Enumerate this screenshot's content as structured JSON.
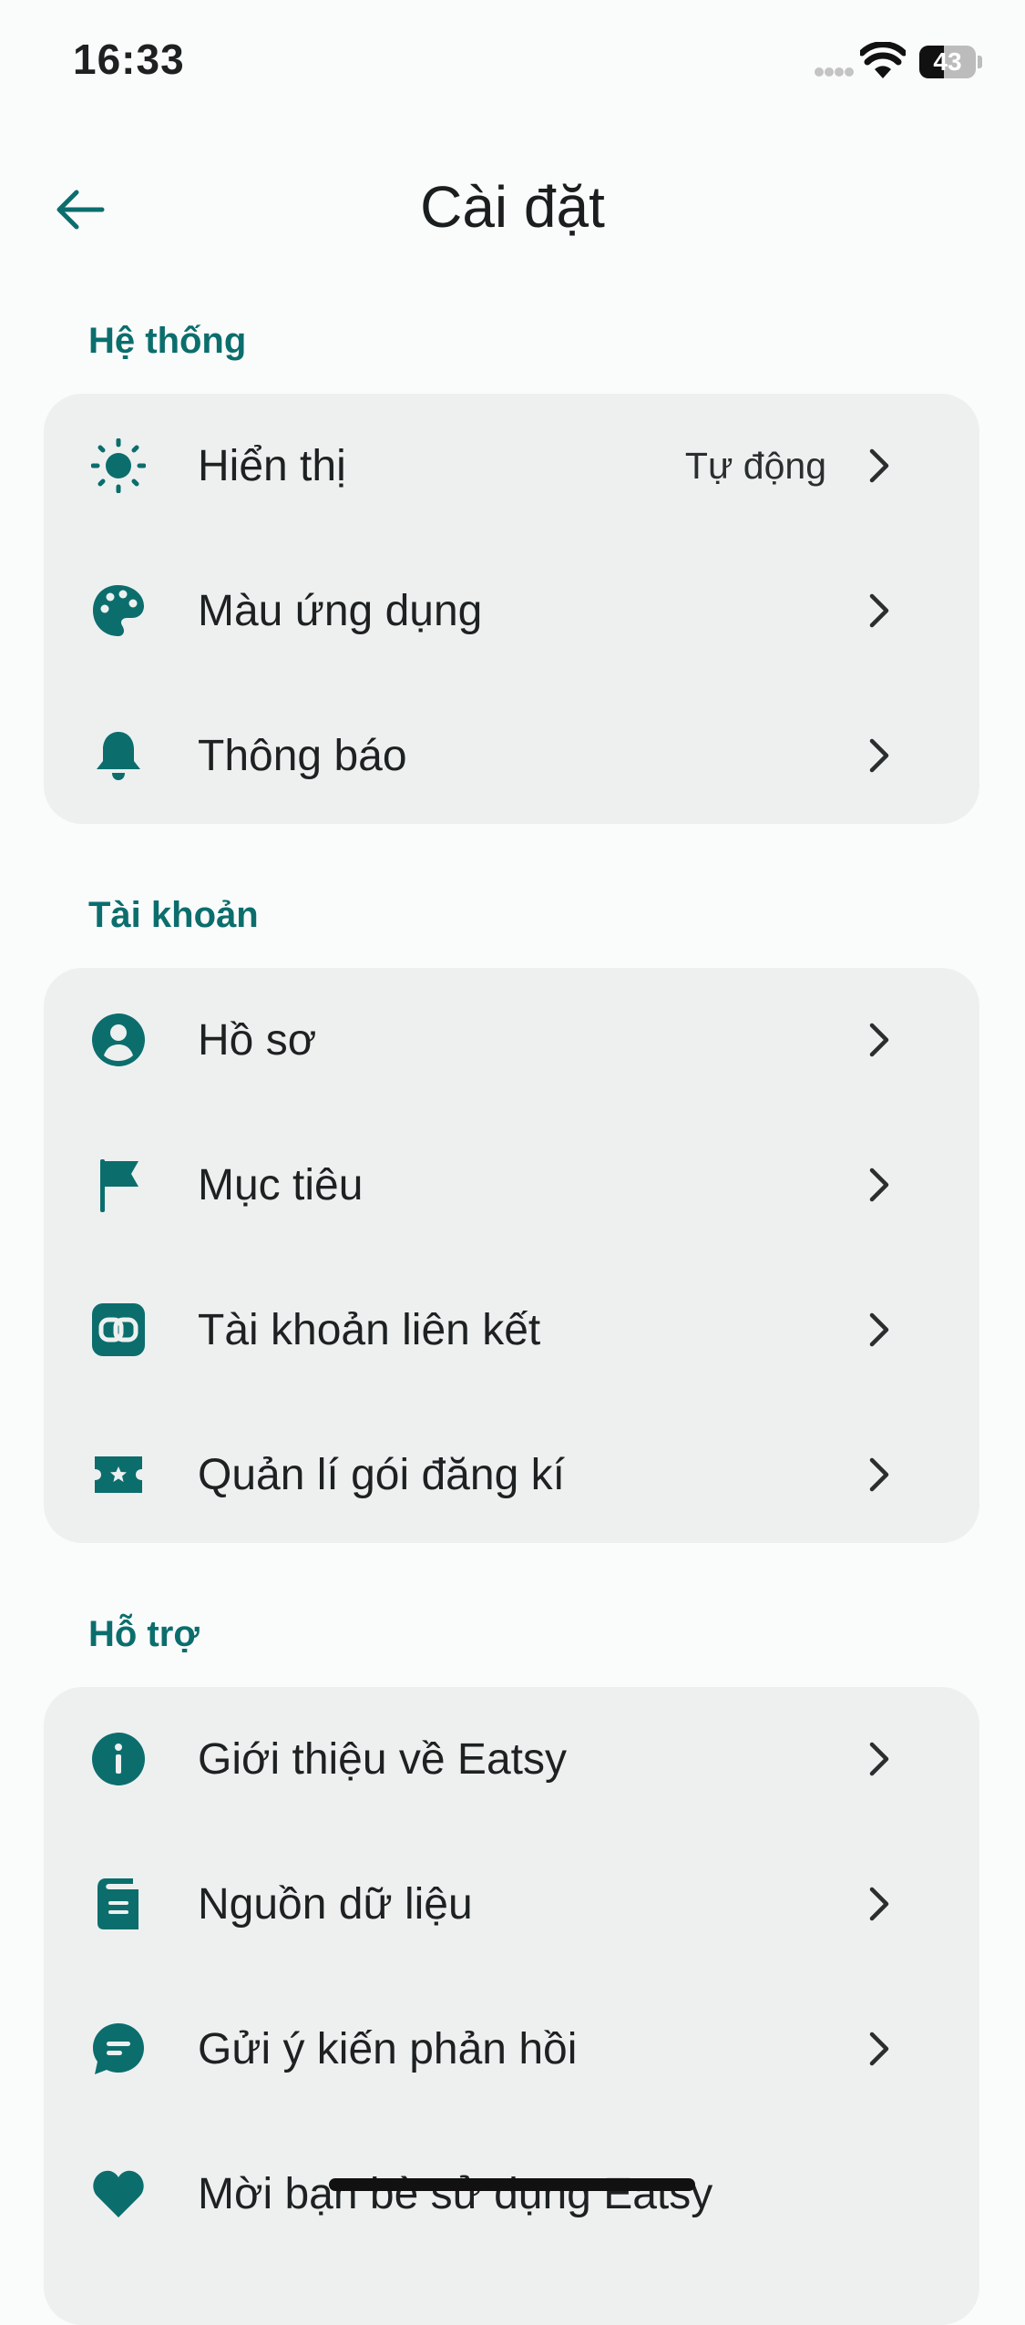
{
  "status_bar": {
    "time": "16:33",
    "battery": "43",
    "battery_level": 0.43
  },
  "header": {
    "title": "Cài đặt"
  },
  "sections": [
    {
      "title": "Hệ thống",
      "items": [
        {
          "label": "Hiển thị",
          "value": "Tự động",
          "icon": "sun-icon"
        },
        {
          "label": "Màu ứng dụng",
          "icon": "palette-icon"
        },
        {
          "label": "Thông báo",
          "icon": "bell-icon"
        }
      ]
    },
    {
      "title": "Tài khoản",
      "items": [
        {
          "label": "Hồ sơ",
          "icon": "profile-icon"
        },
        {
          "label": "Mục tiêu",
          "icon": "flag-icon"
        },
        {
          "label": "Tài khoản liên kết",
          "icon": "link-icon"
        },
        {
          "label": "Quản lí gói đăng kí",
          "icon": "ticket-icon"
        }
      ]
    },
    {
      "title": "Hỗ trợ",
      "items": [
        {
          "label": "Giới thiệu về Eatsy",
          "icon": "info-icon"
        },
        {
          "label": "Nguồn dữ liệu",
          "icon": "book-icon"
        },
        {
          "label": "Gửi ý kiến phản hồi",
          "icon": "feedback-icon"
        },
        {
          "label": "Mời bạn bè sử dụng Eatsy",
          "icon": "heart-icon"
        }
      ]
    }
  ],
  "colors": {
    "accent": "#0b6e6d",
    "background": "#fafbfb",
    "card": "#eef0f0",
    "text": "#1e2121"
  }
}
